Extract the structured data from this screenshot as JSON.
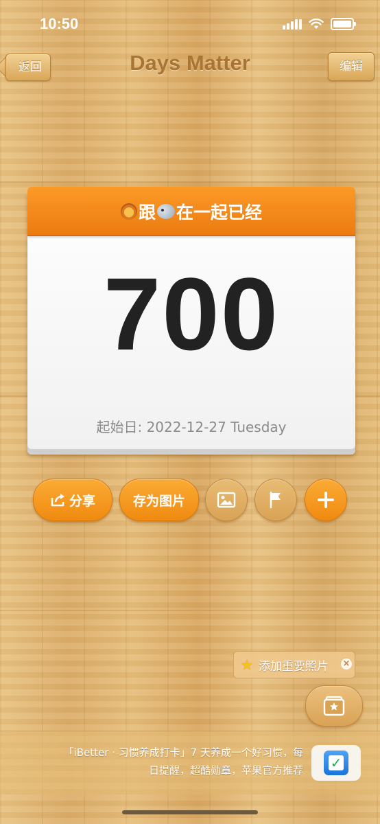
{
  "status_bar": {
    "time": "10:50"
  },
  "nav": {
    "back_label": "返回",
    "title": "Days Matter",
    "edit_label": "编辑"
  },
  "card": {
    "title": "跟 在一起已经",
    "title_part1": "跟",
    "title_part2": "在一起已经",
    "count": "700",
    "start_date": "起始日: 2022-12-27 Tuesday"
  },
  "actions": {
    "share_label": "分享",
    "save_image_label": "存为图片",
    "icons": [
      "share-icon",
      "photo-background-icon",
      "flag-icon",
      "plus-icon"
    ]
  },
  "tip": {
    "label": "添加重要照片"
  },
  "ad": {
    "line1": "「iBetter · 习惯养成打卡」7 天养成一个好习惯，每",
    "line2": "日提醒，超酷勋章，苹果官方推荐"
  },
  "colors": {
    "accent_orange": "#f08a10",
    "header_orange": "#fb9a27",
    "wood_light": "#e8c282",
    "wood_dark": "#d9a862",
    "title_brown": "#a87536"
  }
}
